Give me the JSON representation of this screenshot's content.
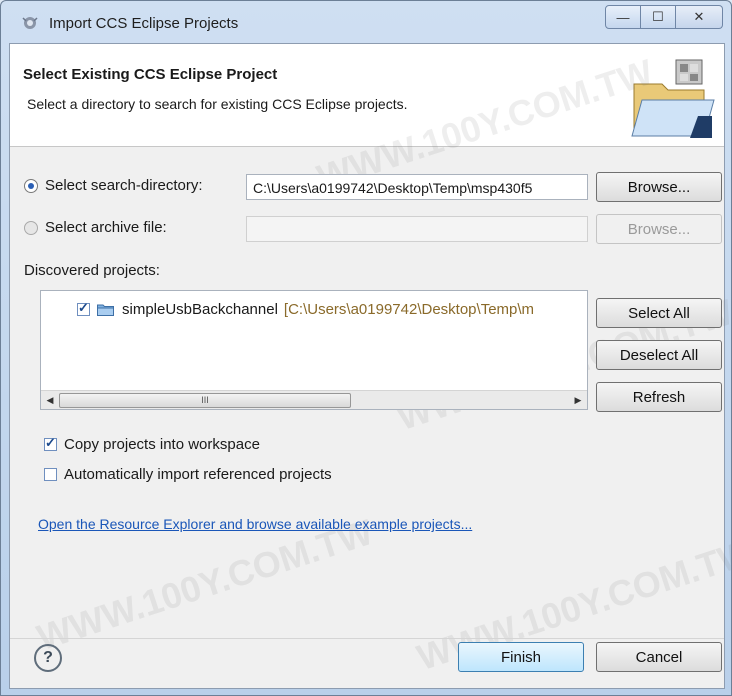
{
  "window": {
    "title": "Import CCS Eclipse Projects",
    "controls": {
      "minimize": "—",
      "maximize": "☐",
      "close": "✕"
    }
  },
  "banner": {
    "title": "Select Existing CCS Eclipse Project",
    "description": "Select a directory to search for existing CCS Eclipse projects."
  },
  "search_directory": {
    "label": "Select search-directory:",
    "value": "C:\\Users\\a0199742\\Desktop\\Temp\\msp430f5",
    "browse_label": "Browse...",
    "selected": true
  },
  "archive_file": {
    "label": "Select archive file:",
    "value": "",
    "browse_label": "Browse...",
    "selected": false
  },
  "discovered": {
    "label": "Discovered projects:",
    "projects": [
      {
        "name": "simpleUsbBackchannel",
        "path": "[C:\\Users\\a0199742\\Desktop\\Temp\\m",
        "checked": true
      }
    ],
    "scroll_thumb_glyph": "III"
  },
  "list_buttons": {
    "select_all": "Select All",
    "deselect_all": "Deselect All",
    "refresh": "Refresh"
  },
  "options": {
    "copy_projects": {
      "label": "Copy projects into workspace",
      "checked": true
    },
    "auto_import": {
      "label": "Automatically import referenced projects",
      "checked": false
    }
  },
  "resource_link": "Open the Resource Explorer and browse available example projects...",
  "footer": {
    "help_glyph": "?",
    "finish": "Finish",
    "cancel": "Cancel"
  },
  "watermark": "WWW.100Y.COM.TW",
  "colors": {
    "link": "#1a56b8",
    "project_path": "#8a6a2a",
    "primary_button": "#bee6fd"
  }
}
